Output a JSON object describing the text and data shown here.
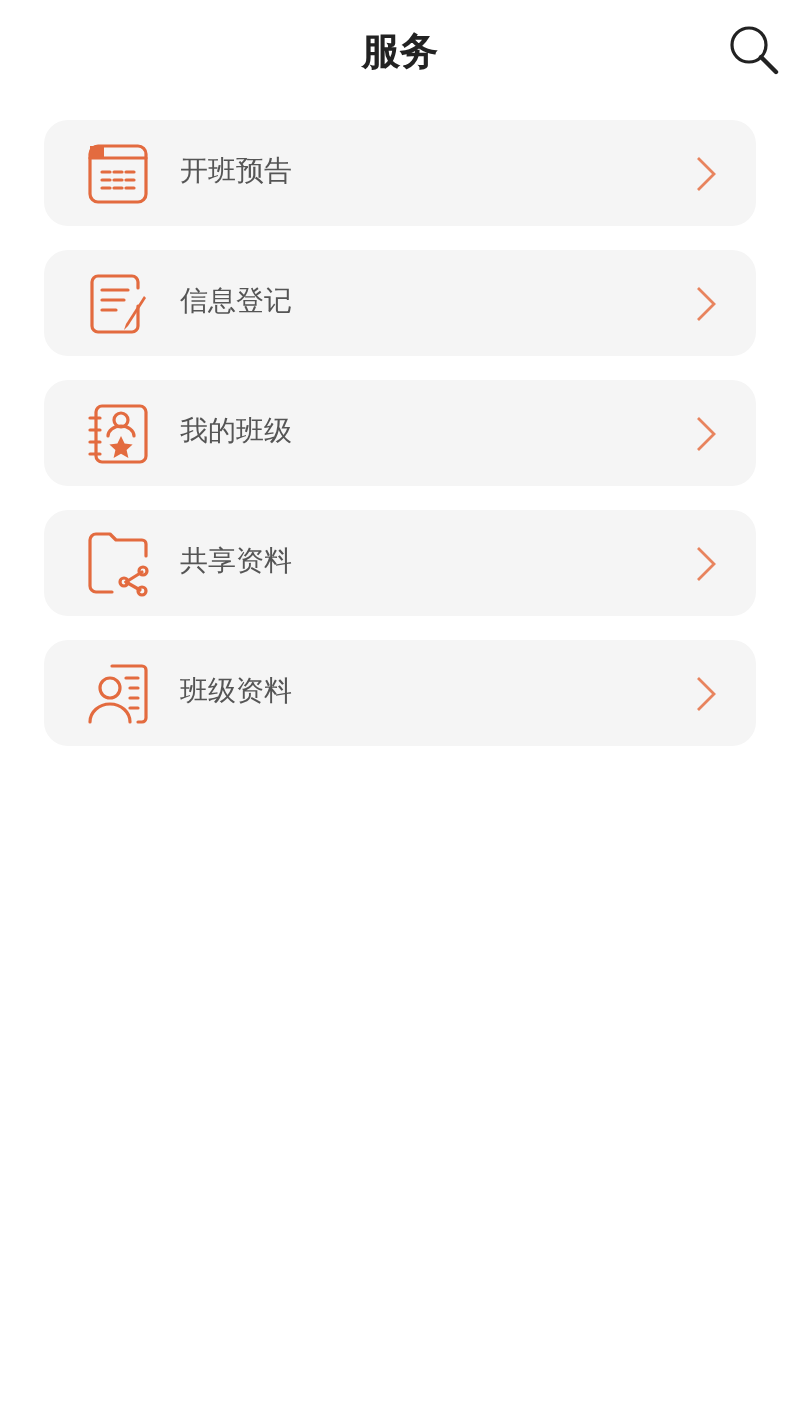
{
  "header": {
    "title": "服务"
  },
  "items": [
    {
      "kind": "announcement",
      "label": "开班预告"
    },
    {
      "kind": "register",
      "label": "信息登记"
    },
    {
      "kind": "class",
      "label": "我的班级"
    },
    {
      "kind": "shared",
      "label": "共享资料"
    },
    {
      "kind": "profile",
      "label": "班级资料"
    }
  ]
}
